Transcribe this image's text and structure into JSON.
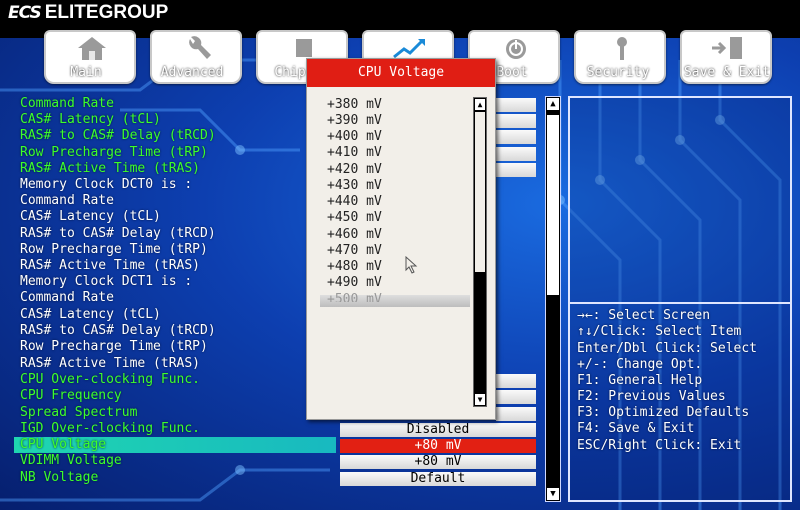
{
  "brand": {
    "mark": "ECS",
    "name": "ELITEGROUP"
  },
  "tabs": [
    {
      "label": "Main",
      "icon": "home-icon"
    },
    {
      "label": "Advanced",
      "icon": "wrench-icon"
    },
    {
      "label": "Chip",
      "icon": "chip-icon"
    },
    {
      "label": "",
      "icon": "chart-icon"
    },
    {
      "label": "Boot",
      "icon": "power-icon"
    },
    {
      "label": "Security",
      "icon": "key-icon"
    },
    {
      "label": "Save & Exit",
      "icon": "exit-door-icon"
    }
  ],
  "items": [
    {
      "label": "Command Rate",
      "color": "green"
    },
    {
      "label": "CAS# Latency (tCL)",
      "color": "green"
    },
    {
      "label": "RAS# to CAS# Delay (tRCD)",
      "color": "green"
    },
    {
      "label": "Row Precharge Time (tRP)",
      "color": "green"
    },
    {
      "label": "RAS# Active Time (tRAS)",
      "color": "green"
    },
    {
      "label": "Memory Clock DCT0 is :",
      "color": "white"
    },
    {
      "label": "Command Rate",
      "color": "white"
    },
    {
      "label": "CAS# Latency (tCL)",
      "color": "white"
    },
    {
      "label": "RAS# to CAS# Delay (tRCD)",
      "color": "white"
    },
    {
      "label": "Row Precharge Time (tRP)",
      "color": "white"
    },
    {
      "label": "RAS# Active Time (tRAS)",
      "color": "white"
    },
    {
      "label": "Memory Clock DCT1 is :",
      "color": "white"
    },
    {
      "label": "Command Rate",
      "color": "white"
    },
    {
      "label": "CAS# Latency (tCL)",
      "color": "white"
    },
    {
      "label": "RAS# to CAS# Delay (tRCD)",
      "color": "white"
    },
    {
      "label": "Row Precharge Time (tRP)",
      "color": "white"
    },
    {
      "label": "RAS# Active Time (tRAS)",
      "color": "white"
    },
    {
      "label": "CPU Over-clocking Func.",
      "color": "green"
    },
    {
      "label": "CPU Frequency",
      "color": "green"
    },
    {
      "label": "Spread Spectrum",
      "color": "green"
    },
    {
      "label": "IGD Over-clocking Func.",
      "color": "green"
    },
    {
      "label": "CPU Voltage",
      "color": "green"
    },
    {
      "label": "VDIMM Voltage",
      "color": "green"
    },
    {
      "label": "NB Voltage",
      "color": "green"
    }
  ],
  "values": {
    "igd_overclock": "Disabled",
    "cpu_voltage": "+80 mV",
    "vdimm_voltage": "+80 mV",
    "nb_voltage": "Default"
  },
  "popup": {
    "title": "CPU Voltage",
    "options": [
      "+380 mV",
      "+390 mV",
      "+400 mV",
      "+410 mV",
      "+420 mV",
      "+430 mV",
      "+440 mV",
      "+450 mV",
      "+460 mV",
      "+470 mV",
      "+480 mV",
      "+490 mV",
      "+500 mV"
    ],
    "highlighted": "+500 mV"
  },
  "help": [
    "→←: Select Screen",
    "↑↓/Click: Select Item",
    "Enter/Dbl Click: Select",
    "+/-: Change Opt.",
    "F1: General Help",
    "F2: Previous Values",
    "F3: Optimized Defaults",
    "F4: Save & Exit",
    "ESC/Right Click: Exit"
  ],
  "colors": {
    "accent_red": "#e01e14",
    "selected_bar": "#1fd6b0",
    "label_green": "#3dff2a",
    "background_blue": "#0d3fb0"
  }
}
